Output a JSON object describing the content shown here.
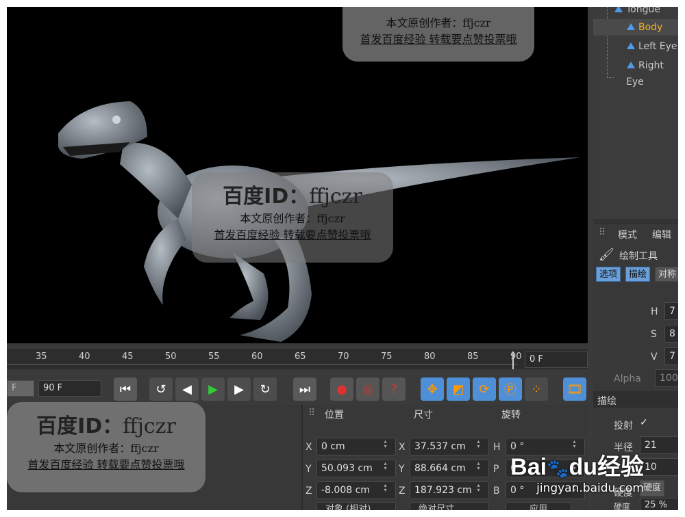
{
  "object_manager": {
    "items": [
      {
        "label": "Tongue",
        "selected": false
      },
      {
        "label": "Body",
        "selected": true
      },
      {
        "label": "Left Eye",
        "selected": false
      },
      {
        "label": "Right Eye",
        "selected": false
      }
    ]
  },
  "timeline": {
    "ticks": [
      "35",
      "40",
      "45",
      "50",
      "55",
      "60",
      "65",
      "70",
      "75",
      "80",
      "85",
      "90"
    ],
    "current_frame": "0 F",
    "end_frame": "90 F",
    "start_frame_partial": "F"
  },
  "attribute": {
    "headers": {
      "position": "位置",
      "size": "尺寸",
      "rotation": "旋转"
    },
    "rows": [
      {
        "axis": "X",
        "pos": "0 cm",
        "size_axis": "X",
        "size": "37.537 cm",
        "rot_axis": "H",
        "rot": "0 °"
      },
      {
        "axis": "Y",
        "pos": "50.093 cm",
        "size_axis": "Y",
        "size": "88.664 cm",
        "rot_axis": "P",
        "rot": "0 °"
      },
      {
        "axis": "Z",
        "pos": "-8.008 cm",
        "size_axis": "Z",
        "size": "187.923 cm",
        "rot_axis": "B",
        "rot": "0 °"
      }
    ],
    "coord_mode": "对象 (相对)",
    "size_mode": "绝对尺寸",
    "apply_label": "应用"
  },
  "right_panel": {
    "menu_mode": "模式",
    "menu_edit": "编辑",
    "tool_title": "绘制工具",
    "tabs": [
      "选项",
      "描绘",
      "对称"
    ],
    "hsv": [
      {
        "label": "H",
        "value": "7"
      },
      {
        "label": "S",
        "value": "8"
      },
      {
        "label": "V",
        "value": "7"
      }
    ],
    "alpha_label": "Alpha",
    "alpha_value": "100",
    "section": "描绘",
    "projection_label": "投射",
    "projection_check": "✓",
    "radius_label": "半径",
    "radius_value": "21",
    "strength_value": "10",
    "hardness_label": "硬度",
    "hardness_tab": "硬度",
    "hardness_label2": "硬度",
    "hardness_value": "25 %",
    "strength_partial": "强度"
  },
  "watermarks": {
    "title": "百度ID：",
    "id": "ffjczr",
    "line1": "本文原创作者：ffjczr",
    "line2": "首发百度经验 转载要点赞投票哦"
  },
  "baidu_logo": {
    "text": "Bai",
    "paw": "du",
    "cn": "经验",
    "url": "jingyan.baidu.com"
  },
  "colors": {
    "selected_text": "#f0b429",
    "accent_blue": "#4f8fd8",
    "play_green": "#33cc33"
  }
}
